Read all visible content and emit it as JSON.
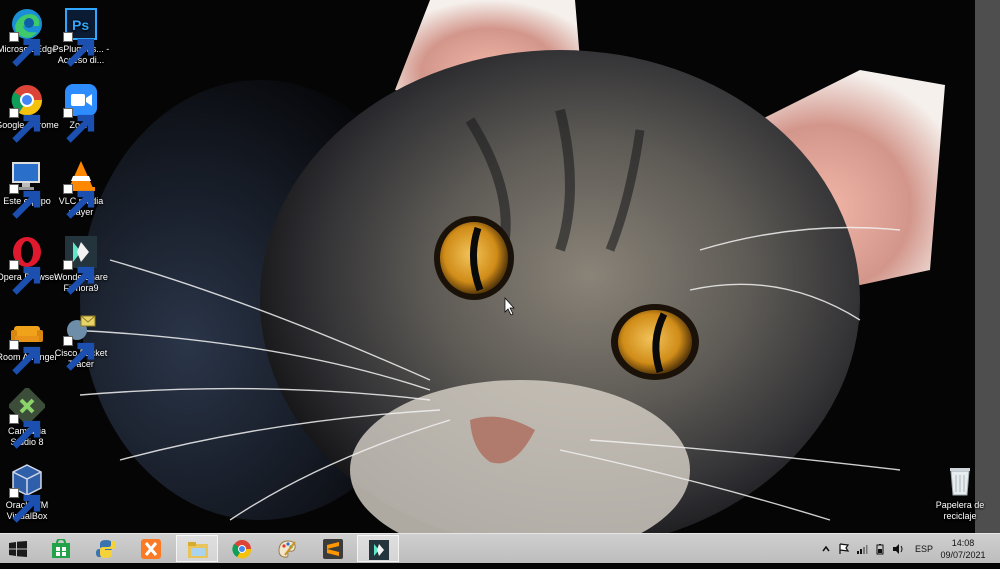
{
  "desktop": {
    "icons": [
      {
        "label": "Microsoft Edge",
        "icon": "edge-icon"
      },
      {
        "label": "PsPlug-Ins... - Acceso di...",
        "icon": "photoshop-icon"
      },
      {
        "label": "Google Chrome",
        "icon": "chrome-icon"
      },
      {
        "label": "Zoom",
        "icon": "zoom-icon"
      },
      {
        "label": "Este equipo",
        "icon": "computer-icon"
      },
      {
        "label": "VLC media player",
        "icon": "vlc-icon"
      },
      {
        "label": "Opera Browser",
        "icon": "opera-icon"
      },
      {
        "label": "Wondershare Filmora9",
        "icon": "filmora-icon"
      },
      {
        "label": "Room Arranger",
        "icon": "sofa-icon"
      },
      {
        "label": "Cisco Packet Tracer",
        "icon": "packet-tracer-icon"
      },
      {
        "label": "Camtasia Studio 8",
        "icon": "camtasia-icon"
      },
      {
        "label": "Oracle VM VirtualBox",
        "icon": "virtualbox-icon"
      },
      {
        "label": "Papelera de reciclaje",
        "icon": "recycle-bin-icon"
      }
    ]
  },
  "taskbar": {
    "pinned": [
      {
        "name": "store-icon"
      },
      {
        "name": "python-icon"
      },
      {
        "name": "xampp-icon"
      },
      {
        "name": "file-explorer-icon"
      },
      {
        "name": "chrome-icon"
      },
      {
        "name": "paint-icon"
      },
      {
        "name": "sublime-text-icon"
      },
      {
        "name": "filmora-icon"
      }
    ],
    "tray": {
      "language": "ESP",
      "time": "14:08",
      "date": "09/07/2021"
    }
  },
  "colors": {
    "taskbar": "#c6c6c6",
    "cat_eye": "#d89a1c",
    "desktop_text": "#ffffff"
  }
}
